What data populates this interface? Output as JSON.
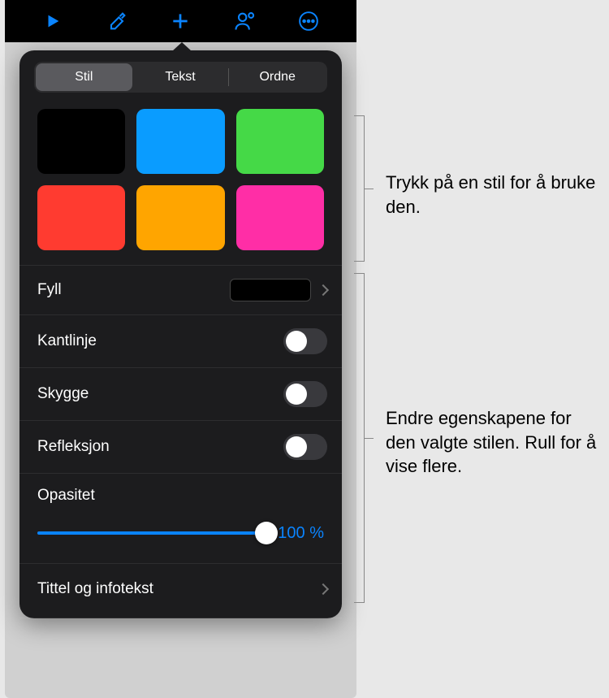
{
  "toolbar": {
    "icons": [
      "play",
      "brush",
      "plus",
      "collaborate",
      "more"
    ]
  },
  "tabs": {
    "style": "Stil",
    "text": "Tekst",
    "arrange": "Ordne",
    "active": "style"
  },
  "swatches": [
    "#000000",
    "#0a9cff",
    "#45d947",
    "#ff3b30",
    "#ffa500",
    "#ff2ea6"
  ],
  "rows": {
    "fill": {
      "label": "Fyll"
    },
    "border": {
      "label": "Kantlinje",
      "on": false
    },
    "shadow": {
      "label": "Skygge",
      "on": false
    },
    "reflection": {
      "label": "Refleksjon",
      "on": false
    },
    "opacity": {
      "label": "Opasitet",
      "value": "100 %"
    },
    "title": {
      "label": "Tittel og infotekst"
    }
  },
  "callouts": {
    "swatches": "Trykk på en stil for å bruke den.",
    "properties": "Endre egenskapene for den valgte stilen. Rull for å vise flere."
  }
}
